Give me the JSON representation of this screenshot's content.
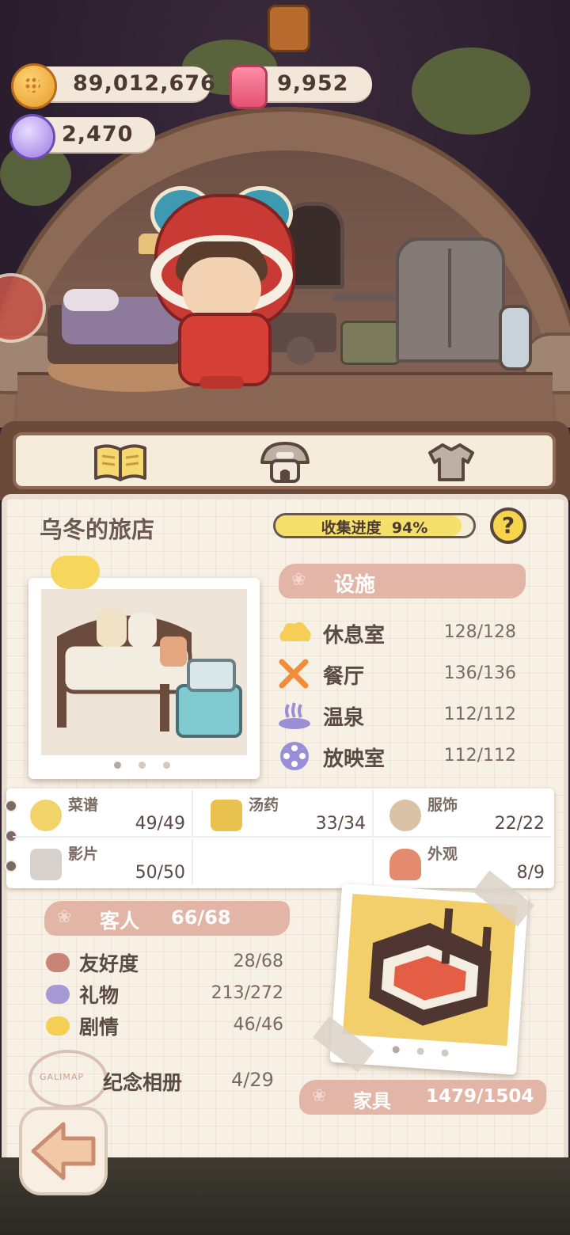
{
  "currency": {
    "coins": "89,012,676",
    "candles": "9,952",
    "gems": "2,470"
  },
  "tabs": [
    {
      "name": "guide-book",
      "icon": "open-book-icon",
      "selected": true
    },
    {
      "name": "hotel",
      "icon": "mushroom-hotel-icon",
      "selected": false
    },
    {
      "name": "outfit",
      "icon": "shirt-icon",
      "selected": false
    }
  ],
  "inn": {
    "title": "乌冬的旅店",
    "progress_label": "收集进度",
    "progress_value": "94%",
    "progress_fraction": 0.94,
    "help_label": "?"
  },
  "facilities": {
    "header": "设施",
    "items": [
      {
        "label": "休息室",
        "count": "128/128",
        "icon": "cloud-icon",
        "color": "#f5cf55"
      },
      {
        "label": "餐厅",
        "count": "136/136",
        "icon": "fork-knife-icon",
        "color": "#f08c3a"
      },
      {
        "label": "温泉",
        "count": "112/112",
        "icon": "hot-spring-icon",
        "color": "#9a8fd6"
      },
      {
        "label": "放映室",
        "count": "112/112",
        "icon": "film-reel-icon",
        "color": "#9a8fd6"
      }
    ]
  },
  "collections": [
    {
      "label": "菜谱",
      "count": "49/49",
      "icon": "dish-icon"
    },
    {
      "label": "汤药",
      "count": "33/34",
      "icon": "potion-jar-icon"
    },
    {
      "label": "服饰",
      "count": "22/22",
      "icon": "costume-icon"
    },
    {
      "label": "影片",
      "count": "50/50",
      "icon": "film-projector-icon"
    },
    {
      "label": "",
      "count": "",
      "icon": ""
    },
    {
      "label": "外观",
      "count": "8/9",
      "icon": "house-icon"
    }
  ],
  "guests": {
    "header": "客人",
    "header_count": "66/68",
    "items": [
      {
        "label": "友好度",
        "count": "28/68",
        "icon": "heart-icon",
        "color": "#c98478"
      },
      {
        "label": "礼物",
        "count": "213/272",
        "icon": "heart-icon",
        "color": "#a59ad6"
      },
      {
        "label": "剧情",
        "count": "46/46",
        "icon": "heart-icon",
        "color": "#f5cf55"
      }
    ],
    "album_label": "纪念相册",
    "album_count": "4/29",
    "stamp_text": "GALIMAP"
  },
  "furniture": {
    "label": "家具",
    "count": "1479/1504"
  }
}
